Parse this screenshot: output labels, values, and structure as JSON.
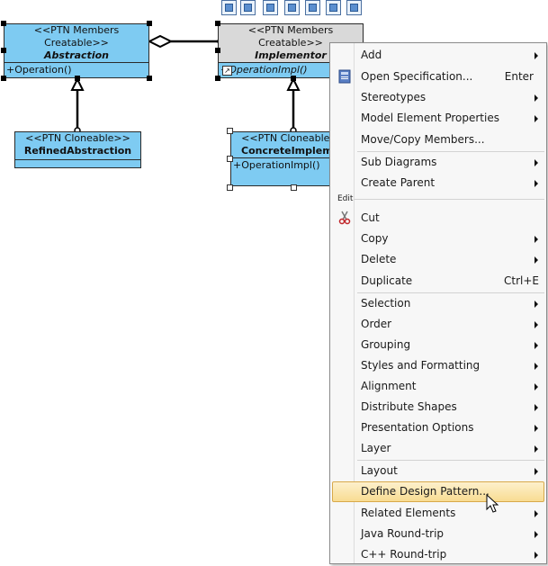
{
  "diagram": {
    "abstraction": {
      "stereotype": "<<PTN Members Creatable>>",
      "name": "Abstraction",
      "operation": "+Operation()"
    },
    "implementor": {
      "stereotype": "<<PTN Members Creatable>>",
      "name": "Implementor",
      "operation": "+OperationImpl()"
    },
    "refined": {
      "stereotype": "<<PTN Cloneable>>",
      "name": "RefinedAbstraction"
    },
    "concrete": {
      "stereotype": "<<PTN Cloneable>>",
      "name": "ConcreteImplemen",
      "operation": "+OperationImpl()"
    }
  },
  "menu": {
    "items": [
      {
        "label": "Add",
        "submenu": true
      },
      {
        "label": "Open Specification...",
        "shortcut": "Enter",
        "icon": "specification-icon"
      },
      {
        "label": "Stereotypes",
        "submenu": true
      },
      {
        "label": "Model Element Properties",
        "submenu": true
      },
      {
        "label": "Move/Copy Members..."
      },
      {
        "label": "Sub Diagrams",
        "submenu": true
      },
      {
        "label": "Create Parent",
        "submenu": true
      },
      {
        "label": "Cut",
        "icon": "scissors-icon"
      },
      {
        "label": "Copy",
        "submenu": true
      },
      {
        "label": "Delete",
        "submenu": true
      },
      {
        "label": "Duplicate",
        "shortcut": "Ctrl+E"
      },
      {
        "label": "Selection",
        "submenu": true
      },
      {
        "label": "Order",
        "submenu": true
      },
      {
        "label": "Grouping",
        "submenu": true
      },
      {
        "label": "Styles and Formatting",
        "submenu": true
      },
      {
        "label": "Alignment",
        "submenu": true
      },
      {
        "label": "Distribute Shapes",
        "submenu": true
      },
      {
        "label": "Presentation Options",
        "submenu": true
      },
      {
        "label": "Layer",
        "submenu": true
      },
      {
        "label": "Layout",
        "submenu": true
      },
      {
        "label": "Define Design Pattern...",
        "highlighted": true
      },
      {
        "label": "Related Elements",
        "submenu": true
      },
      {
        "label": "Java Round-trip",
        "submenu": true
      },
      {
        "label": "C++ Round-trip",
        "submenu": true
      }
    ],
    "edit_header": "Edit"
  },
  "colors": {
    "class_fill": "#7ecbf2",
    "selected_fill": "#d9d9d9",
    "highlight": "#f8dc92"
  }
}
